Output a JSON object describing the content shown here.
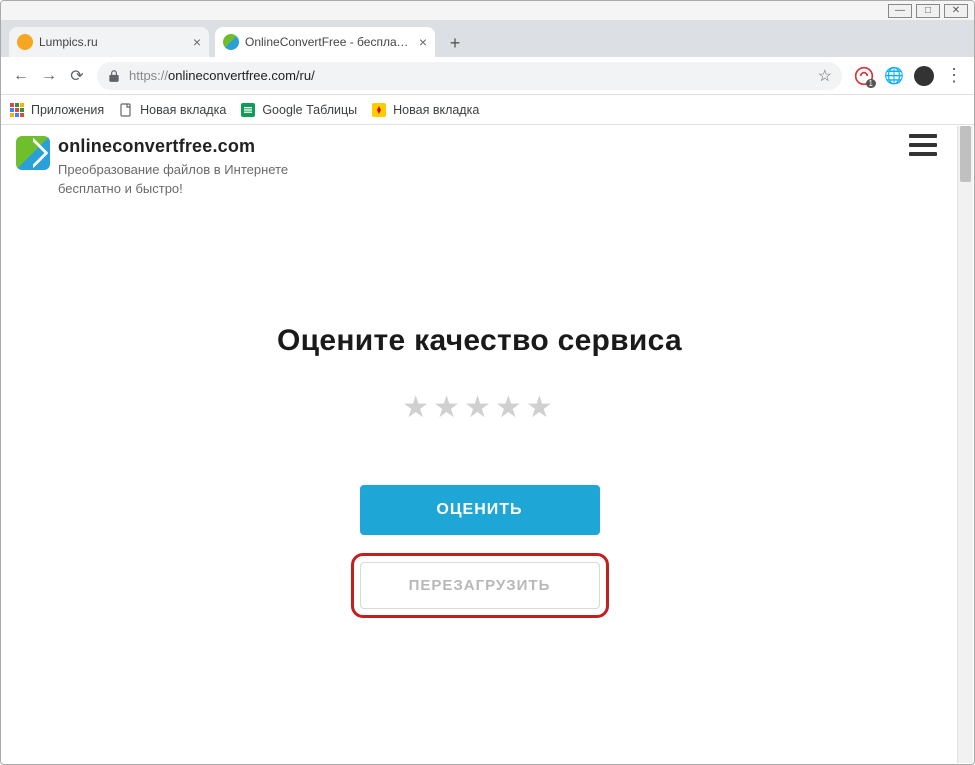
{
  "window": {
    "minimize": "—",
    "maximize": "□",
    "close": "✕"
  },
  "tabs": [
    {
      "title": "Lumpics.ru",
      "active": false,
      "favicon_color": "#f6a623"
    },
    {
      "title": "OnlineConvertFree - бесплатный",
      "active": true,
      "favicon_color": "#2aa0d8"
    }
  ],
  "new_tab": "+",
  "nav": {
    "back": "←",
    "forward": "→",
    "reload": "⟳"
  },
  "omnibox": {
    "protocol": "https://",
    "host_path": "onlineconvertfree.com/ru/",
    "star": "☆"
  },
  "extensions": {
    "adblock_badge": "1",
    "globe": "🌐"
  },
  "menu_dots": "⋮",
  "bookmarks": {
    "apps": "Приложения",
    "new_tab_1": "Новая вкладка",
    "sheets": "Google Таблицы",
    "new_tab_2": "Новая вкладка"
  },
  "site": {
    "title": "onlineconvertfree.com",
    "subtitle_line1": "Преобразование файлов в Интернете",
    "subtitle_line2": "бесплатно и быстро!"
  },
  "rating": {
    "heading": "Оцените качество сервиса",
    "stars": "★★★★★",
    "rate_button": "ОЦЕНИТЬ",
    "reload_button": "ПЕРЕЗАГРУЗИТЬ"
  }
}
